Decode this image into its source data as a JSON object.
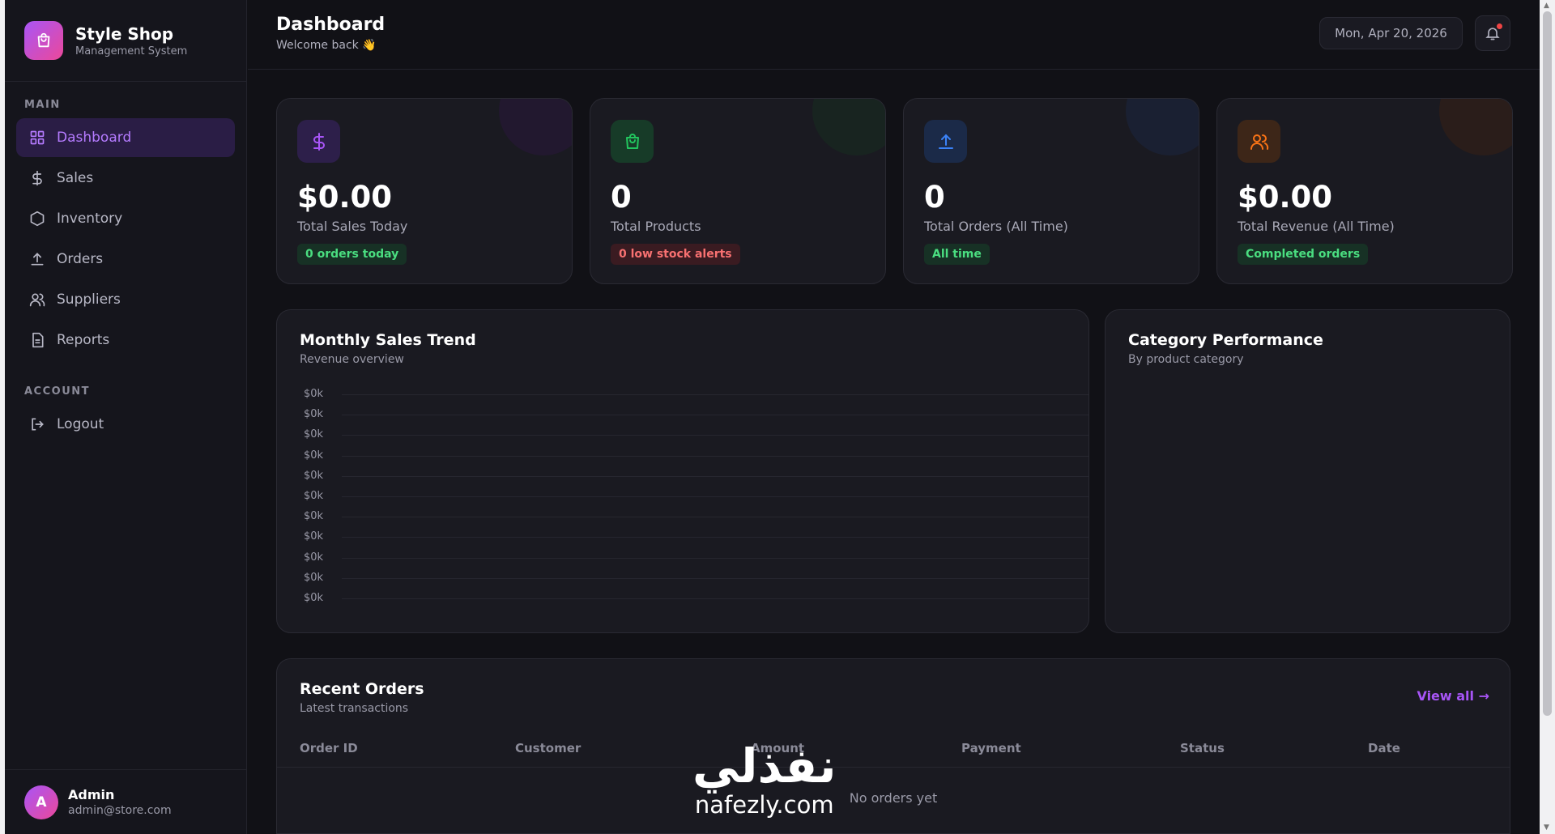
{
  "brand": {
    "name": "Style Shop",
    "subtitle": "Management System"
  },
  "nav": {
    "main_label": "MAIN",
    "items": [
      {
        "label": "Dashboard",
        "icon": "grid-icon",
        "active": true
      },
      {
        "label": "Sales",
        "icon": "dollar-icon"
      },
      {
        "label": "Inventory",
        "icon": "hexagon-icon"
      },
      {
        "label": "Orders",
        "icon": "upload-icon"
      },
      {
        "label": "Suppliers",
        "icon": "users-icon"
      },
      {
        "label": "Reports",
        "icon": "file-icon"
      }
    ],
    "account_label": "ACCOUNT",
    "logout_label": "Logout"
  },
  "user": {
    "initial": "A",
    "name": "Admin",
    "email": "admin@store.com"
  },
  "header": {
    "title": "Dashboard",
    "subtitle": "Welcome back 👋",
    "date": "Mon, Apr 20, 2026"
  },
  "stats": [
    {
      "value": "$0.00",
      "label": "Total Sales Today",
      "badge": "0 orders today",
      "color": "#a855f7"
    },
    {
      "value": "0",
      "label": "Total Products",
      "badge": "0 low stock alerts",
      "color": "#22c55e"
    },
    {
      "value": "0",
      "label": "Total Orders (All Time)",
      "badge": "All time",
      "color": "#3b82f6"
    },
    {
      "value": "$0.00",
      "label": "Total Revenue (All Time)",
      "badge": "Completed orders",
      "color": "#f97316"
    }
  ],
  "sales_chart": {
    "title": "Monthly Sales Trend",
    "subtitle": "Revenue overview",
    "y_ticks": [
      "$0k",
      "$0k",
      "$0k",
      "$0k",
      "$0k",
      "$0k",
      "$0k",
      "$0k",
      "$0k",
      "$0k",
      "$0k"
    ]
  },
  "category": {
    "title": "Category Performance",
    "subtitle": "By product category"
  },
  "orders": {
    "title": "Recent Orders",
    "subtitle": "Latest transactions",
    "view_all": "View all →",
    "columns": [
      "Order ID",
      "Customer",
      "Amount",
      "Payment",
      "Status",
      "Date"
    ],
    "empty": "No orders yet"
  },
  "watermark": {
    "arabic": "نفذلي",
    "latin": "nafezly.com"
  }
}
